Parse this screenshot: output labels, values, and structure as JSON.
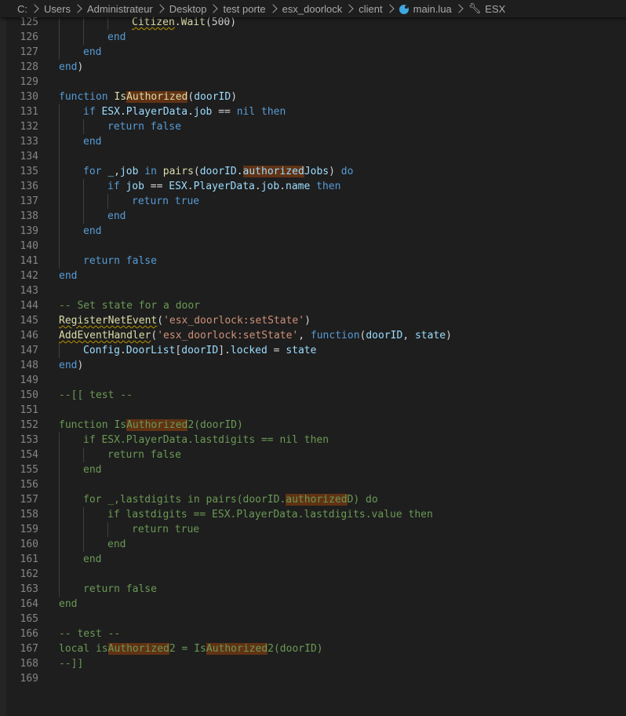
{
  "breadcrumb": {
    "items": [
      "C:",
      "Users",
      "Administrateur",
      "Desktop",
      "test porte",
      "esx_doorlock",
      "client",
      "main.lua",
      "ESX"
    ],
    "icons": {
      "file": "lua-file-icon",
      "symbol": "wrench-icon"
    }
  },
  "colors": {
    "background": "#1e1e1e",
    "keyword": "#569cd6",
    "function": "#dcdcaa",
    "variable": "#9cdcfe",
    "string": "#ce9178",
    "comment": "#6a9955",
    "highlight": "#613214",
    "line_number": "#858585"
  },
  "editor": {
    "lines": [
      {
        "n": "125",
        "indent": 3,
        "tokens": [
          [
            "Citizen",
            "fn sq"
          ],
          [
            ".",
            ""
          ],
          [
            "Wait",
            "fn"
          ],
          [
            "(500)",
            ""
          ]
        ]
      },
      {
        "n": "126",
        "indent": 2,
        "tokens": [
          [
            "end",
            "kw"
          ]
        ]
      },
      {
        "n": "127",
        "indent": 1,
        "tokens": [
          [
            "end",
            "kw"
          ]
        ]
      },
      {
        "n": "128",
        "indent": 0,
        "tokens": [
          [
            "end",
            "kw"
          ],
          [
            ")",
            ""
          ]
        ]
      },
      {
        "n": "129",
        "indent": 0,
        "tokens": []
      },
      {
        "n": "130",
        "indent": 0,
        "tokens": [
          [
            "function ",
            "kw"
          ],
          [
            "Is",
            "fn"
          ],
          [
            "Authorized",
            "fn hl"
          ],
          [
            "(",
            ""
          ],
          [
            "doorID",
            "var"
          ],
          [
            ")",
            ""
          ]
        ]
      },
      {
        "n": "131",
        "indent": 1,
        "tokens": [
          [
            "if ",
            "kw"
          ],
          [
            "ESX",
            "var"
          ],
          [
            ".",
            ""
          ],
          [
            "PlayerData",
            "var"
          ],
          [
            ".",
            ""
          ],
          [
            "job",
            "var"
          ],
          [
            " == ",
            ""
          ],
          [
            "nil",
            "kw"
          ],
          [
            " then",
            "kw"
          ]
        ]
      },
      {
        "n": "132",
        "indent": 2,
        "tokens": [
          [
            "return ",
            "kw"
          ],
          [
            "false",
            "kw"
          ]
        ]
      },
      {
        "n": "133",
        "indent": 1,
        "tokens": [
          [
            "end",
            "kw"
          ]
        ]
      },
      {
        "n": "134",
        "indent": 1,
        "tokens": []
      },
      {
        "n": "135",
        "indent": 1,
        "tokens": [
          [
            "for ",
            "kw"
          ],
          [
            "_",
            "var"
          ],
          [
            ",",
            ""
          ],
          [
            "job",
            "var"
          ],
          [
            " in ",
            "kw"
          ],
          [
            "pairs",
            "fn"
          ],
          [
            "(",
            ""
          ],
          [
            "doorID",
            "var"
          ],
          [
            ".",
            ""
          ],
          [
            "authorized",
            "var hl"
          ],
          [
            "Jobs",
            "var"
          ],
          [
            ") ",
            ""
          ],
          [
            "do",
            "kw"
          ]
        ]
      },
      {
        "n": "136",
        "indent": 2,
        "tokens": [
          [
            "if ",
            "kw"
          ],
          [
            "job",
            "var"
          ],
          [
            " == ",
            ""
          ],
          [
            "ESX",
            "var"
          ],
          [
            ".",
            ""
          ],
          [
            "PlayerData",
            "var"
          ],
          [
            ".",
            ""
          ],
          [
            "job",
            "var"
          ],
          [
            ".",
            ""
          ],
          [
            "name",
            "var"
          ],
          [
            " then",
            "kw"
          ]
        ]
      },
      {
        "n": "137",
        "indent": 3,
        "tokens": [
          [
            "return ",
            "kw"
          ],
          [
            "true",
            "kw"
          ]
        ]
      },
      {
        "n": "138",
        "indent": 2,
        "tokens": [
          [
            "end",
            "kw"
          ]
        ]
      },
      {
        "n": "139",
        "indent": 1,
        "tokens": [
          [
            "end",
            "kw"
          ]
        ]
      },
      {
        "n": "140",
        "indent": 1,
        "tokens": []
      },
      {
        "n": "141",
        "indent": 1,
        "tokens": [
          [
            "return ",
            "kw"
          ],
          [
            "false",
            "kw"
          ]
        ]
      },
      {
        "n": "142",
        "indent": 0,
        "tokens": [
          [
            "end",
            "kw"
          ]
        ]
      },
      {
        "n": "143",
        "indent": 0,
        "tokens": []
      },
      {
        "n": "144",
        "indent": 0,
        "tokens": [
          [
            "-- Set state for a door",
            "cmt"
          ]
        ]
      },
      {
        "n": "145",
        "indent": 0,
        "tokens": [
          [
            "RegisterNetEvent",
            "fn sq"
          ],
          [
            "(",
            ""
          ],
          [
            "'esx_doorlock:setState'",
            "str"
          ],
          [
            ")",
            ""
          ]
        ]
      },
      {
        "n": "146",
        "indent": 0,
        "tokens": [
          [
            "AddEventHandler",
            "fn sq"
          ],
          [
            "(",
            ""
          ],
          [
            "'esx_doorlock:setState'",
            "str"
          ],
          [
            ", ",
            ""
          ],
          [
            "function",
            "kw"
          ],
          [
            "(",
            ""
          ],
          [
            "doorID",
            "var"
          ],
          [
            ", ",
            ""
          ],
          [
            "state",
            "var"
          ],
          [
            ")",
            ""
          ]
        ]
      },
      {
        "n": "147",
        "indent": 1,
        "tokens": [
          [
            "Config",
            "var"
          ],
          [
            ".",
            ""
          ],
          [
            "DoorList",
            "var"
          ],
          [
            "[",
            ""
          ],
          [
            "doorID",
            "var"
          ],
          [
            "].",
            ""
          ],
          [
            "locked",
            "var"
          ],
          [
            " = ",
            ""
          ],
          [
            "state",
            "var"
          ]
        ]
      },
      {
        "n": "148",
        "indent": 0,
        "tokens": [
          [
            "end",
            "kw"
          ],
          [
            ")",
            ""
          ]
        ]
      },
      {
        "n": "149",
        "indent": 0,
        "tokens": []
      },
      {
        "n": "150",
        "indent": 0,
        "tokens": [
          [
            "--[[ test --",
            "cmt"
          ]
        ]
      },
      {
        "n": "151",
        "indent": 0,
        "tokens": []
      },
      {
        "n": "152",
        "indent": 0,
        "tokens": [
          [
            "function Is",
            "cmt"
          ],
          [
            "Authorized",
            "cmt hl"
          ],
          [
            "2(doorID)",
            "cmt"
          ]
        ]
      },
      {
        "n": "153",
        "indent": 1,
        "tokens": [
          [
            "if ESX.PlayerData.lastdigits == nil then",
            "cmt"
          ]
        ]
      },
      {
        "n": "154",
        "indent": 2,
        "tokens": [
          [
            "return false",
            "cmt"
          ]
        ]
      },
      {
        "n": "155",
        "indent": 1,
        "tokens": [
          [
            "end",
            "cmt"
          ]
        ]
      },
      {
        "n": "156",
        "indent": 1,
        "tokens": []
      },
      {
        "n": "157",
        "indent": 1,
        "tokens": [
          [
            "for _,lastdigits in pairs(doorID.",
            "cmt"
          ],
          [
            "authorized",
            "cmt hl"
          ],
          [
            "D) do",
            "cmt"
          ]
        ]
      },
      {
        "n": "158",
        "indent": 2,
        "tokens": [
          [
            "if lastdigits == ESX.PlayerData.lastdigits.value then",
            "cmt"
          ]
        ]
      },
      {
        "n": "159",
        "indent": 3,
        "tokens": [
          [
            "return true",
            "cmt"
          ]
        ]
      },
      {
        "n": "160",
        "indent": 2,
        "tokens": [
          [
            "end",
            "cmt"
          ]
        ]
      },
      {
        "n": "161",
        "indent": 1,
        "tokens": [
          [
            "end",
            "cmt"
          ]
        ]
      },
      {
        "n": "162",
        "indent": 1,
        "tokens": []
      },
      {
        "n": "163",
        "indent": 1,
        "tokens": [
          [
            "return false",
            "cmt"
          ]
        ]
      },
      {
        "n": "164",
        "indent": 0,
        "tokens": [
          [
            "end",
            "cmt"
          ]
        ]
      },
      {
        "n": "165",
        "indent": 0,
        "tokens": []
      },
      {
        "n": "166",
        "indent": 0,
        "tokens": [
          [
            "-- test --",
            "cmt"
          ]
        ]
      },
      {
        "n": "167",
        "indent": 0,
        "tokens": [
          [
            "local is",
            "cmt"
          ],
          [
            "Authorized",
            "cmt hl"
          ],
          [
            "2 = Is",
            "cmt"
          ],
          [
            "Authorized",
            "cmt hl"
          ],
          [
            "2(doorID)",
            "cmt"
          ]
        ]
      },
      {
        "n": "168",
        "indent": 0,
        "tokens": [
          [
            "--]]",
            "cmt"
          ]
        ]
      },
      {
        "n": "169",
        "indent": 0,
        "tokens": []
      }
    ]
  }
}
